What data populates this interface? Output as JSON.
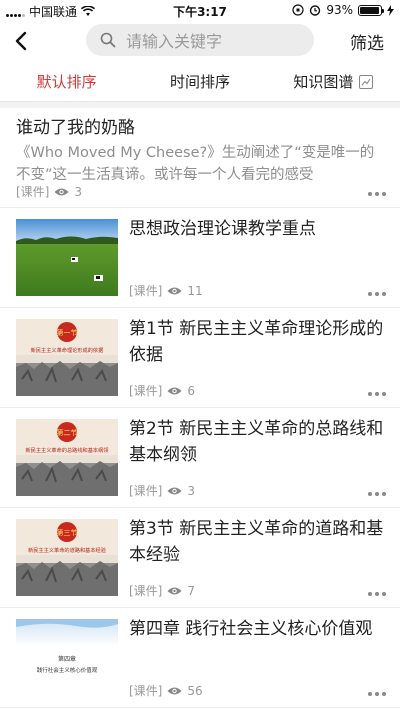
{
  "status_bar": {
    "carrier": "中国联通",
    "time": "下午3:17",
    "battery": "93%",
    "battery_level": 0.93
  },
  "nav": {
    "back_icon": "chevron-left-icon",
    "search_placeholder": "请输入关键字",
    "filter_label": "筛选"
  },
  "tabs": [
    {
      "label": "默认排序",
      "active": true
    },
    {
      "label": "时间排序",
      "active": false
    },
    {
      "label": "知识图谱",
      "active": false,
      "icon": "graph-icon"
    }
  ],
  "items": [
    {
      "title": "谁动了我的奶酪",
      "desc": "《Who Moved My Cheese?》生动阐述了“变是唯一的不变”这一生活真谛。或许每一个人看完的感受",
      "tag": "[课件]",
      "views": "3"
    },
    {
      "title": "思想政治理论课教学重点",
      "tag": "[课件]",
      "views": "11",
      "thumb": "pasture"
    },
    {
      "title": "第1节  新民主主义革命理论形成的依据",
      "tag": "[课件]",
      "views": "6",
      "thumb": "relief",
      "badge": "第一节",
      "thumb_text": "新民主主义革命理论形成的依据"
    },
    {
      "title": "第2节  新民主主义革命的总路线和基本纲领",
      "tag": "[课件]",
      "views": "3",
      "thumb": "relief",
      "badge": "第二节",
      "thumb_text": "新民主主义革命的总路线和基本纲领"
    },
    {
      "title": "第3节  新民主主义革命的道路和基本经验",
      "tag": "[课件]",
      "views": "7",
      "thumb": "relief",
      "badge": "第三节",
      "thumb_text": "新民主主义革命的道路和基本经验"
    },
    {
      "title": "第四章 践行社会主义核心价值观",
      "tag": "[课件]",
      "views": "56",
      "thumb": "slide",
      "thumb_title": "第四章",
      "thumb_text": "践行社会主义核心价值观"
    }
  ],
  "colors": {
    "accent": "#d23b3b",
    "text": "#222222",
    "muted": "#999999"
  }
}
